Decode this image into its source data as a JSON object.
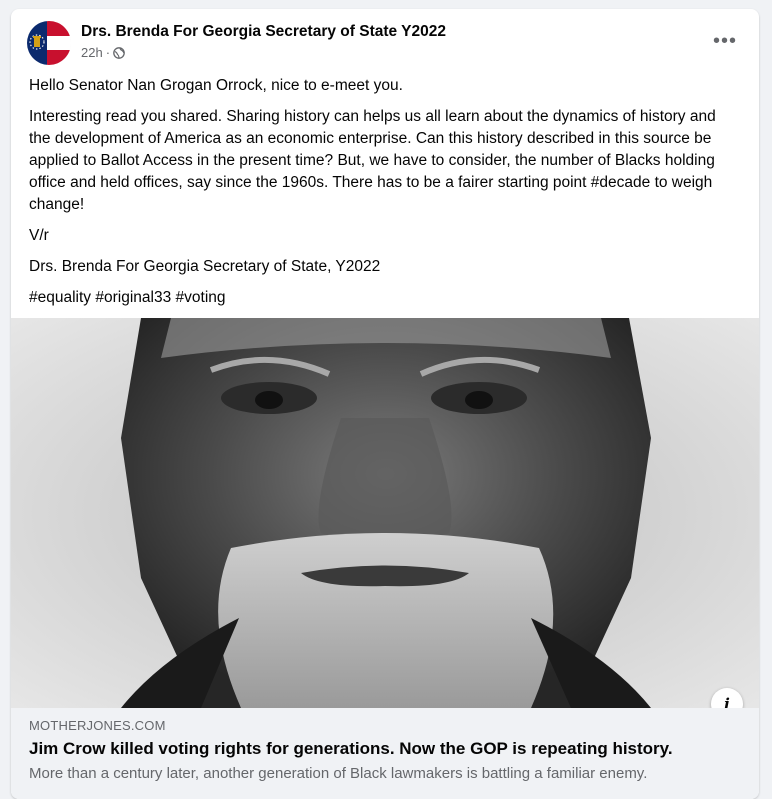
{
  "post": {
    "page_name": "Drs. Brenda For Georgia Secretary of State Y2022",
    "time": "22h",
    "separator": "·",
    "audience_icon": "globe-icon",
    "more_label": "•••",
    "greeting": "Hello Senator Nan Grogan Orrock, nice to e-meet you.",
    "paragraph": "Interesting read you shared. Sharing history can helps us all learn about the dynamics of history and the development of America as an economic enterprise. Can this history described in this source be applied to Ballot Access in the present time? But, we have to consider, the number of Blacks holding office and held offices, say since the 1960s. There has to be a fairer starting point #decade to weigh change!",
    "signoff": "V/r",
    "signature": "Drs. Brenda For Georgia Secretary of State, Y2022",
    "hashtags": [
      "#equality",
      "#original33",
      "#voting"
    ]
  },
  "link": {
    "domain": "MOTHERJONES.COM",
    "title": "Jim Crow killed voting rights for generations. Now the GOP is repeating history.",
    "description": "More than a century later, another generation of Black lawmakers is battling a familiar enemy.",
    "info_label": "i"
  },
  "colors": {
    "background": "#f0f2f5",
    "card": "#ffffff",
    "text_primary": "#050505",
    "text_secondary": "#65676b"
  }
}
